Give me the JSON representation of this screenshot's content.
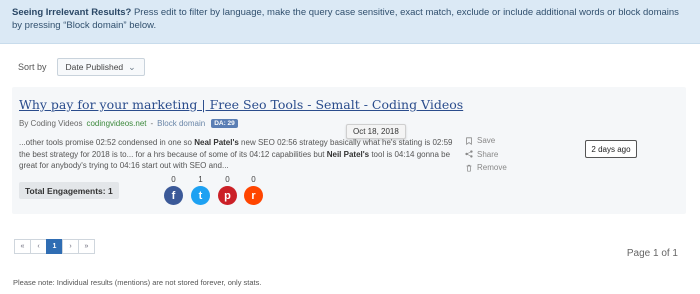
{
  "notice": {
    "heading": "Seeing Irrelevant Results?",
    "text": " Press edit to filter by language, make the query case sensitive, exact match, exclude or include additional words or block domains by pressing “Block domain” below."
  },
  "sort": {
    "label": "Sort by",
    "selected": "Date Published"
  },
  "result": {
    "title": "Why pay for your marketing | Free Seo Tools - Semalt - Coding Videos",
    "by": "By Coding Videos",
    "domain": "codingvideos.net",
    "domain_sep": "-",
    "block_domain": "Block domain",
    "da_badge": "DA: 29",
    "tooltip_date": "Oct 18, 2018",
    "snippet": {
      "s1": "...other tools promise 02:52 condensed in one so ",
      "b1": "Neal Patel's",
      "s2": " new SEO 02:56 strategy basically what he's stating is 02:59 the best strategy for 2018 is to... for a hrs because of some of its 04:12 capabilities but ",
      "b2": "Neil Patel's",
      "s3": " tool is 04:14 gonna be great for anybody's trying to 04:16 start out with SEO and..."
    },
    "actions": {
      "save": "Save",
      "share": "Share",
      "remove": "Remove"
    },
    "age": "2 days ago",
    "engagements": "Total Engagements: 1",
    "social": [
      {
        "network": "facebook",
        "icon": "facebook-icon",
        "count": "0",
        "color": "#3b5998",
        "glyph": "f"
      },
      {
        "network": "twitter",
        "icon": "twitter-icon",
        "count": "1",
        "color": "#1da1f2",
        "glyph": "t"
      },
      {
        "network": "pinterest",
        "icon": "pinterest-icon",
        "count": "0",
        "color": "#cb2027",
        "glyph": "p"
      },
      {
        "network": "reddit",
        "icon": "reddit-icon",
        "count": "0",
        "color": "#ff4500",
        "glyph": "r"
      }
    ]
  },
  "pagination": {
    "first": "«",
    "prev": "‹",
    "current": "1",
    "next": "›",
    "last": "»",
    "page_info": "Page 1 of 1"
  },
  "footer_note": "Please note: Individual results (mentions) are not stored forever, only stats."
}
